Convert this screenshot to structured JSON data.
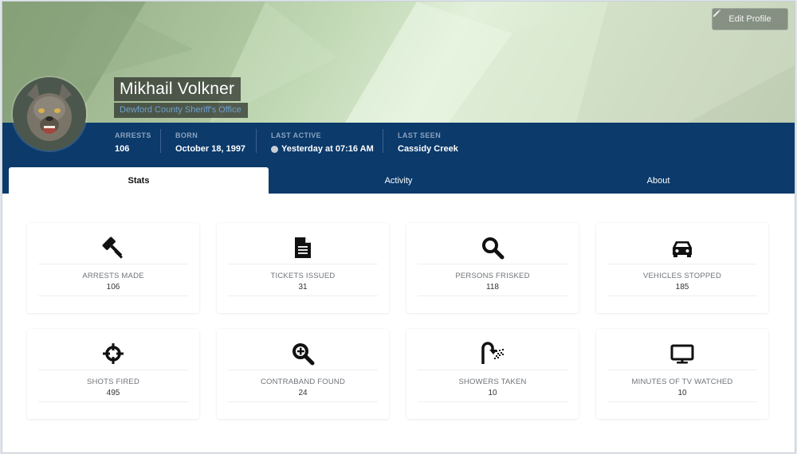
{
  "header": {
    "edit_label": "Edit Profile",
    "name": "Mikhail Volkner",
    "agency": "Dewford County Sheriff's Office"
  },
  "info": {
    "arrests_label": "ARRESTS",
    "arrests_value": "106",
    "born_label": "BORN",
    "born_value": "October 18, 1997",
    "last_active_label": "LAST ACTIVE",
    "last_active_value": "Yesterday at 07:16 AM",
    "last_seen_label": "LAST SEEN",
    "last_seen_value": "Cassidy Creek"
  },
  "tabs": [
    {
      "label": "Stats",
      "active": true
    },
    {
      "label": "Activity",
      "active": false
    },
    {
      "label": "About",
      "active": false
    }
  ],
  "stats": [
    {
      "icon": "gavel-icon",
      "label": "ARRESTS MADE",
      "value": "106"
    },
    {
      "icon": "document-icon",
      "label": "TICKETS ISSUED",
      "value": "31"
    },
    {
      "icon": "search-icon",
      "label": "PERSONS FRISKED",
      "value": "118"
    },
    {
      "icon": "car-icon",
      "label": "VEHICLES STOPPED",
      "value": "185"
    },
    {
      "icon": "crosshairs-icon",
      "label": "SHOTS FIRED",
      "value": "495"
    },
    {
      "icon": "search-plus-icon",
      "label": "CONTRABAND FOUND",
      "value": "24"
    },
    {
      "icon": "shower-icon",
      "label": "SHOWERS TAKEN",
      "value": "10"
    },
    {
      "icon": "tv-icon",
      "label": "MINUTES OF TV WATCHED",
      "value": "10"
    }
  ],
  "colors": {
    "infobar": "#0b3a6b",
    "agency_text": "#6ea1cf"
  }
}
